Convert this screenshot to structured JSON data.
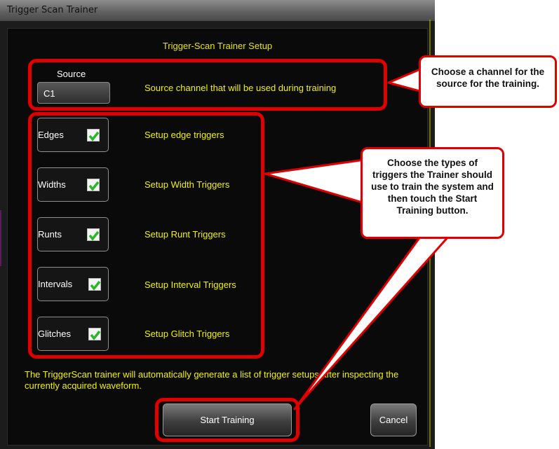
{
  "window": {
    "title": "Trigger Scan Trainer"
  },
  "dialog": {
    "heading": "Trigger-Scan Trainer Setup"
  },
  "source": {
    "label": "Source",
    "value": "C1",
    "description": "Source channel that will be used during training"
  },
  "triggers": [
    {
      "label": "Edges",
      "checked": true,
      "description": "Setup edge triggers"
    },
    {
      "label": "Widths",
      "checked": true,
      "description": "Setup Width Triggers"
    },
    {
      "label": "Runts",
      "checked": true,
      "description": "Setup Runt Triggers"
    },
    {
      "label": "Intervals",
      "checked": true,
      "description": "Setup Interval Triggers"
    },
    {
      "label": "Glitches",
      "checked": true,
      "description": "Setup Glitch Triggers"
    }
  ],
  "note": "The TriggerScan trainer will automatically generate a list of trigger setups after inspecting the currently acquired waveform.",
  "buttons": {
    "start": "Start Training",
    "cancel": "Cancel"
  },
  "callouts": {
    "source": "Choose a channel for the source for the training.",
    "triggers": "Choose the types of triggers the Trainer should use to train the system and then touch the Start Training button."
  },
  "colors": {
    "highlight": "#e00000",
    "accent_text": "#f2f200",
    "check": "#2bb52b"
  }
}
